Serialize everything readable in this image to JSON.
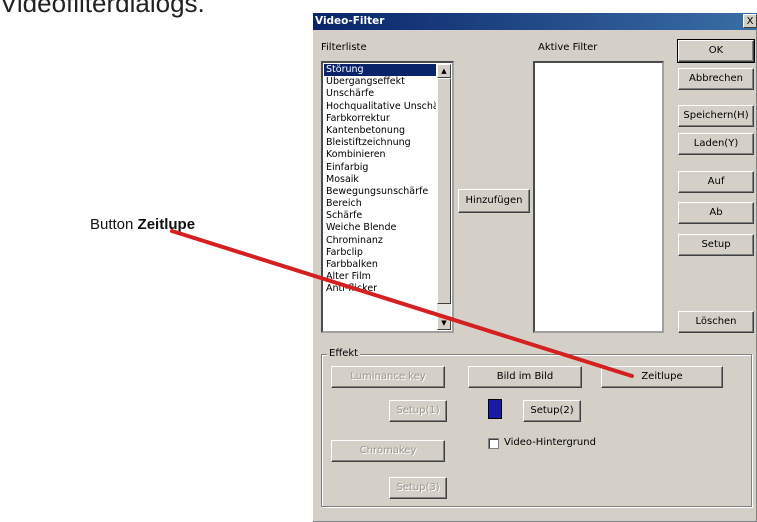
{
  "caption": "Videofilterdialogs.",
  "callout": {
    "prefix": "Button ",
    "bold": "Zeitlupe"
  },
  "dialog": {
    "title": "Video-Filter",
    "close_label": "X",
    "filter_list_label": "Filterliste",
    "active_filter_label": "Aktive Filter",
    "filters": [
      "Störung",
      "Übergangseffekt",
      "Unschärfe",
      "Hochqualitative Unschä",
      "Farbkorrektur",
      "Kantenbetonung",
      "Bleistiftzeichnung",
      "Kombinieren",
      "Einfarbig",
      "Mosaik",
      "Bewegungsunschärfe",
      "Bereich",
      "Schärfe",
      "Weiche Blende",
      "Chrominanz",
      "Farbclip",
      "Farbbalken",
      "Alter Film",
      "Anti-flicker"
    ],
    "selected_filter": "Störung",
    "add_button": "Hinzufügen",
    "right_buttons": {
      "ok": "OK",
      "cancel": "Abbrechen",
      "save": "Speichern(H)",
      "load": "Laden(Y)",
      "up": "Auf",
      "down": "Ab",
      "setup": "Setup",
      "delete": "Löschen"
    },
    "effect": {
      "group_label": "Effekt",
      "luminance_key": "Luminance key",
      "picture_in_picture": "Bild im Bild",
      "slow_motion": "Zeitlupe",
      "setup1": "Setup(1)",
      "setup2": "Setup(2)",
      "video_background": "Video-Hintergrund",
      "chromakey": "Chromakey",
      "setup3": "Setup(3)"
    },
    "colors": {
      "titlebar": "#0a246a",
      "swatch": "#1a1aa8",
      "arrow": "#d42020"
    }
  }
}
